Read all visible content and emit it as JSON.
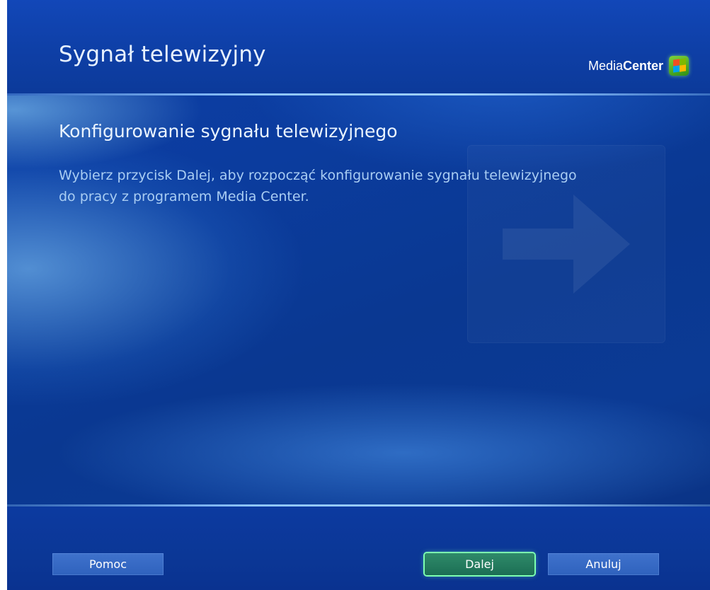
{
  "window": {
    "title": "Sygnał telewizyjny",
    "brand_light": "Media",
    "brand_bold": "Center"
  },
  "main": {
    "heading": "Konfigurowanie sygnału telewizyjnego",
    "description": "Wybierz przycisk Dalej, aby rozpocząć konfigurowanie sygnału telewizyjnego do pracy z programem Media Center."
  },
  "footer": {
    "help_label": "Pomoc",
    "next_label": "Dalej",
    "cancel_label": "Anuluj"
  },
  "icons": {
    "logo": "windows-logo-icon",
    "watermark": "arrow-right-icon"
  },
  "colors": {
    "background": "#0b3a94",
    "focus_highlight": "#7dffb0",
    "button": "#3565c2"
  }
}
